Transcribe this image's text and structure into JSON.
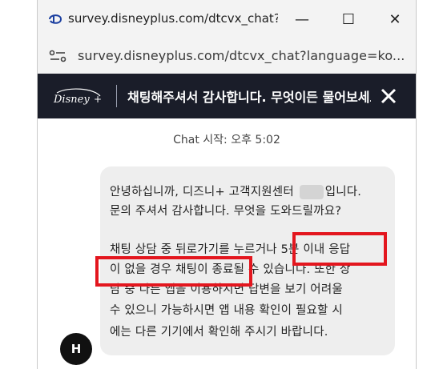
{
  "window": {
    "title": "survey.disneyplus.com/dtcvx_chat?lan...",
    "minimize_glyph": "—",
    "maximize_glyph": "☐",
    "close_glyph": "✕"
  },
  "address_bar": {
    "url": "survey.disneyplus.com/dtcvx_chat?language=ko..."
  },
  "chat_header": {
    "title": "채팅해주셔서 감사합니다. 무엇이든 물어보세요"
  },
  "chat": {
    "start_label": "Chat 시작: 오후 5:02",
    "agent_message": {
      "line1_before": "안녕하십니까, 디즈니+ 고객지원센터 ",
      "line1_after": "입니다.",
      "line2": "문의 주셔서 감사합니다. 무엇을   도와드릴까요?",
      "line3": "채팅 상담 중 뒤로가기를 누르거나 5분 이내 응답",
      "line4": "이 없을 경우 채팅이 종료될 수 있습니다. 또한 상",
      "line5": "담 중 다른 앱을 이용하시면 답변을 보기 어려울",
      "line6": "수 있으니 가능하시면 앱 내용 확인이   필요할 시",
      "line7": "에는 다른 기기에서 확인해 주시기 바랍니다."
    },
    "user_avatar_initial": "H"
  },
  "colors": {
    "header_bg": "#1a1d29",
    "highlight": "#e3161e",
    "bubble_bg": "#eeeeee"
  }
}
